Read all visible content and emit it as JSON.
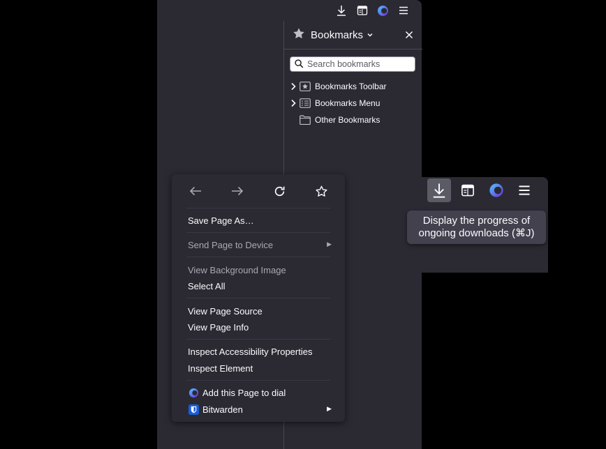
{
  "browser": {
    "toolbar_icons": [
      "downloads-icon",
      "sidebar-icon",
      "speed-dial-icon",
      "menu-icon"
    ]
  },
  "sidebar": {
    "title": "Bookmarks",
    "search_placeholder": "Search bookmarks",
    "items": [
      {
        "label": "Bookmarks Toolbar",
        "icon": "bookmarks-toolbar-icon",
        "expandable": true
      },
      {
        "label": "Bookmarks Menu",
        "icon": "bookmarks-menu-icon",
        "expandable": true
      },
      {
        "label": "Other Bookmarks",
        "icon": "folder-icon",
        "expandable": false
      }
    ]
  },
  "popup": {
    "tooltip": "Display the progress of ongoing downloads (⌘J)"
  },
  "context_menu": {
    "nav": [
      "back",
      "forward",
      "reload",
      "bookmark"
    ],
    "save_page": "Save Page As…",
    "send_page": "Send Page to Device",
    "view_background": "View Background Image",
    "select_all": "Select All",
    "view_source": "View Page Source",
    "view_info": "View Page Info",
    "inspect_accessibility": "Inspect Accessibility Properties",
    "inspect_element": "Inspect Element",
    "add_to_dial": "Add this Page to dial",
    "bitwarden": "Bitwarden"
  },
  "colors": {
    "window_bg": "#2b2a33",
    "menu_text": "#fbfbfe",
    "disabled_text": "#a9a9b1",
    "active_button": "#5b5b66"
  }
}
